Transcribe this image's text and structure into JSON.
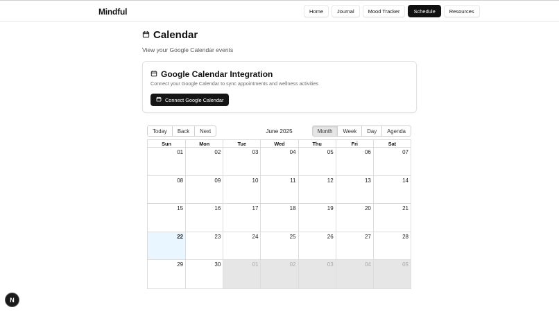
{
  "header": {
    "brand": "Mindful",
    "nav": [
      {
        "label": "Home",
        "active": false
      },
      {
        "label": "Journal",
        "active": false
      },
      {
        "label": "Mood Tracker",
        "active": false
      },
      {
        "label": "Schedule",
        "active": true
      },
      {
        "label": "Resources",
        "active": false
      }
    ]
  },
  "page": {
    "title": "Calendar",
    "title_icon": "calendar-icon",
    "subtitle": "View your Google Calendar events"
  },
  "integration": {
    "title": "Google Calendar Integration",
    "title_icon": "calendar-icon",
    "description": "Connect your Google Calendar to sync appointments and wellness activities",
    "button_label": "Connect Google Calendar",
    "button_icon": "calendar-icon"
  },
  "calendar": {
    "nav_buttons": [
      "Today",
      "Back",
      "Next"
    ],
    "label": "June 2025",
    "views": [
      {
        "label": "Month",
        "active": true
      },
      {
        "label": "Week",
        "active": false
      },
      {
        "label": "Day",
        "active": false
      },
      {
        "label": "Agenda",
        "active": false
      }
    ],
    "weekdays": [
      "Sun",
      "Mon",
      "Tue",
      "Wed",
      "Thu",
      "Fri",
      "Sat"
    ],
    "weeks": [
      [
        {
          "n": "01"
        },
        {
          "n": "02"
        },
        {
          "n": "03"
        },
        {
          "n": "04"
        },
        {
          "n": "05"
        },
        {
          "n": "06"
        },
        {
          "n": "07"
        }
      ],
      [
        {
          "n": "08"
        },
        {
          "n": "09"
        },
        {
          "n": "10"
        },
        {
          "n": "11"
        },
        {
          "n": "12"
        },
        {
          "n": "13"
        },
        {
          "n": "14"
        }
      ],
      [
        {
          "n": "15"
        },
        {
          "n": "16"
        },
        {
          "n": "17"
        },
        {
          "n": "18"
        },
        {
          "n": "19"
        },
        {
          "n": "20"
        },
        {
          "n": "21"
        }
      ],
      [
        {
          "n": "22",
          "today": true
        },
        {
          "n": "23"
        },
        {
          "n": "24"
        },
        {
          "n": "25"
        },
        {
          "n": "26"
        },
        {
          "n": "27"
        },
        {
          "n": "28"
        }
      ],
      [
        {
          "n": "29"
        },
        {
          "n": "30"
        },
        {
          "n": "01",
          "off": true
        },
        {
          "n": "02",
          "off": true
        },
        {
          "n": "03",
          "off": true
        },
        {
          "n": "04",
          "off": true
        },
        {
          "n": "05",
          "off": true
        }
      ]
    ]
  },
  "badge": {
    "label": "N"
  },
  "colors": {
    "primary": "#111111",
    "today": "#eaf6ff",
    "offRange": "#e6e6e6",
    "border": "#dcdcdc"
  }
}
